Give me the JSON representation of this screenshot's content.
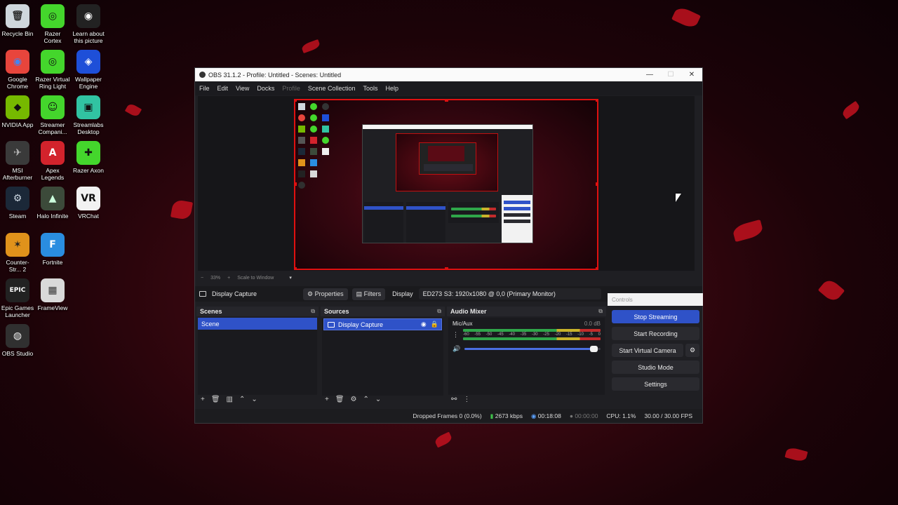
{
  "desktop": {
    "icons": [
      {
        "label": "Recycle Bin",
        "icon": "recycle-bin-icon",
        "glyph": "🗑",
        "bg": "#cfd6dc",
        "fg": "#333"
      },
      {
        "label": "Razer Cortex",
        "icon": "razer-cortex-icon",
        "glyph": "◎",
        "bg": "#44d62c",
        "fg": "#111"
      },
      {
        "label": "Learn about this picture",
        "icon": "learn-picture-icon",
        "glyph": "◉",
        "bg": "#222",
        "fg": "#fff"
      },
      {
        "label": "Google Chrome",
        "icon": "chrome-icon",
        "glyph": "◉",
        "bg": "#e8453c",
        "fg": "#4285f4"
      },
      {
        "label": "Razer Virtual Ring Light",
        "icon": "ring-light-icon",
        "glyph": "◎",
        "bg": "#44d62c",
        "fg": "#111"
      },
      {
        "label": "Wallpaper Engine",
        "icon": "wallpaper-engine-icon",
        "glyph": "◈",
        "bg": "#1e4fd8",
        "fg": "#fff"
      },
      {
        "label": "NVIDIA App",
        "icon": "nvidia-icon",
        "glyph": "◆",
        "bg": "#76b900",
        "fg": "#111"
      },
      {
        "label": "Streamer Compani...",
        "icon": "streamer-companion-icon",
        "glyph": "☺",
        "bg": "#44d62c",
        "fg": "#111"
      },
      {
        "label": "Streamlabs Desktop",
        "icon": "streamlabs-icon",
        "glyph": "▣",
        "bg": "#31c3a2",
        "fg": "#111"
      },
      {
        "label": "MSI Afterburner",
        "icon": "msi-afterburner-icon",
        "glyph": "✈",
        "bg": "#3a3a3a",
        "fg": "#bbb"
      },
      {
        "label": "Apex Legends",
        "icon": "apex-icon",
        "glyph": "A",
        "bg": "#d3232c",
        "fg": "#fff"
      },
      {
        "label": "Razer Axon",
        "icon": "razer-axon-icon",
        "glyph": "✚",
        "bg": "#44d62c",
        "fg": "#111"
      },
      {
        "label": "Steam",
        "icon": "steam-icon",
        "glyph": "⚙",
        "bg": "#1b2838",
        "fg": "#cbd6e0"
      },
      {
        "label": "Halo Infinite",
        "icon": "halo-icon",
        "glyph": "▲",
        "bg": "#3c4a3a",
        "fg": "#cfd"
      },
      {
        "label": "VRChat",
        "icon": "vrchat-icon",
        "glyph": "VR",
        "bg": "#f2f2f2",
        "fg": "#111"
      },
      {
        "label": "Counter-Str... 2",
        "icon": "counter-strike-icon",
        "glyph": "✶",
        "bg": "#e0921b",
        "fg": "#222"
      },
      {
        "label": "Fortnite",
        "icon": "fortnite-icon",
        "glyph": "F",
        "bg": "#2a8de0",
        "fg": "#fff"
      },
      {
        "label": "Epic Games Launcher",
        "icon": "epic-games-icon",
        "glyph": "EPIC",
        "bg": "#222",
        "fg": "#fff"
      },
      {
        "label": "FrameView",
        "icon": "frameview-icon",
        "glyph": "▦",
        "bg": "#d9d9d9",
        "fg": "#333"
      },
      {
        "label": "OBS Studio",
        "icon": "obs-icon",
        "glyph": "◍",
        "bg": "#303030",
        "fg": "#eee"
      }
    ]
  },
  "obs": {
    "title": "OBS 31.1.2 - Profile: Untitled - Scenes: Untitled",
    "menu": [
      "File",
      "Edit",
      "View",
      "Docks",
      "Profile",
      "Scene Collection",
      "Tools",
      "Help"
    ],
    "zoom": {
      "minus": "−",
      "value": "33%",
      "plus": "+",
      "mode": "Scale to Window"
    },
    "context": {
      "source": "Display Capture",
      "properties": "Properties",
      "filters": "Filters",
      "display_label": "Display",
      "display_value": "ED273 S3: 1920x1080 @ 0,0 (Primary Monitor)"
    },
    "scenes": {
      "title": "Scenes",
      "items": [
        "Scene"
      ]
    },
    "sources": {
      "title": "Sources",
      "items": [
        "Display Capture"
      ]
    },
    "mixer": {
      "title": "Audio Mixer",
      "channel": "Mic/Aux",
      "db": "0.0 dB",
      "ticks": [
        "-60",
        "-55",
        "-50",
        "-45",
        "-40",
        "-35",
        "-30",
        "-25",
        "-20",
        "-15",
        "-10",
        "-5",
        "0"
      ],
      "volume_level": 0.98
    },
    "controls": {
      "title": "Controls",
      "stop_streaming": "Stop Streaming",
      "start_recording": "Start Recording",
      "start_virtual_camera": "Start Virtual Camera",
      "studio_mode": "Studio Mode",
      "settings": "Settings"
    },
    "status": {
      "dropped": "Dropped Frames 0 (0.0%)",
      "bitrate": "2673 kbps",
      "stream_time": "00:18:08",
      "rec_time": "00:00:00",
      "cpu": "CPU: 1.1%",
      "fps": "30.00 / 30.00 FPS"
    }
  }
}
